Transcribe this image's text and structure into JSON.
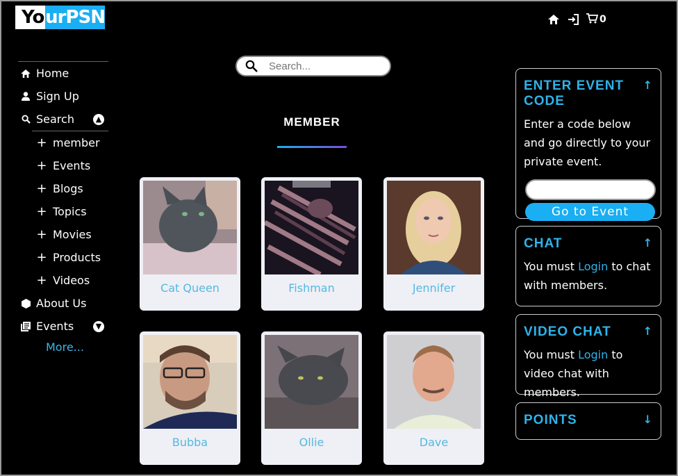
{
  "brand": {
    "logo_left": "Yo",
    "logo_right": "urPSN"
  },
  "topnav": {
    "cart_count": "0"
  },
  "sidebar": {
    "items": [
      {
        "label": "Home"
      },
      {
        "label": "Sign Up"
      },
      {
        "label": "Search"
      }
    ],
    "search_sub": [
      "member",
      "Events",
      "Blogs",
      "Topics",
      "Movies",
      "Products",
      "Videos"
    ],
    "about": "About Us",
    "events": "Events",
    "more": "More..."
  },
  "search": {
    "placeholder": "Search..."
  },
  "main": {
    "heading": "MEMBER"
  },
  "members": [
    {
      "name": "Cat Queen"
    },
    {
      "name": "Fishman"
    },
    {
      "name": "Jennifer"
    },
    {
      "name": "Bubba"
    },
    {
      "name": "Ollie"
    },
    {
      "name": "Dave"
    }
  ],
  "panels": {
    "event": {
      "title": "ENTER EVENT CODE",
      "text": "Enter a code below and go directly to your private event.",
      "button": "Go to Event"
    },
    "chat": {
      "title": "CHAT",
      "pre": "You must ",
      "link": "Login",
      "post": " to chat with members."
    },
    "video": {
      "title": "VIDEO CHAT",
      "pre": "You must ",
      "link": "Login",
      "post": " to video chat with members."
    },
    "points": {
      "title": "POINTS"
    }
  },
  "colors": {
    "accent": "#1aaef2",
    "link": "#2fb3ea",
    "card_bg": "#eef0f6",
    "member_name": "#55b8e0"
  }
}
